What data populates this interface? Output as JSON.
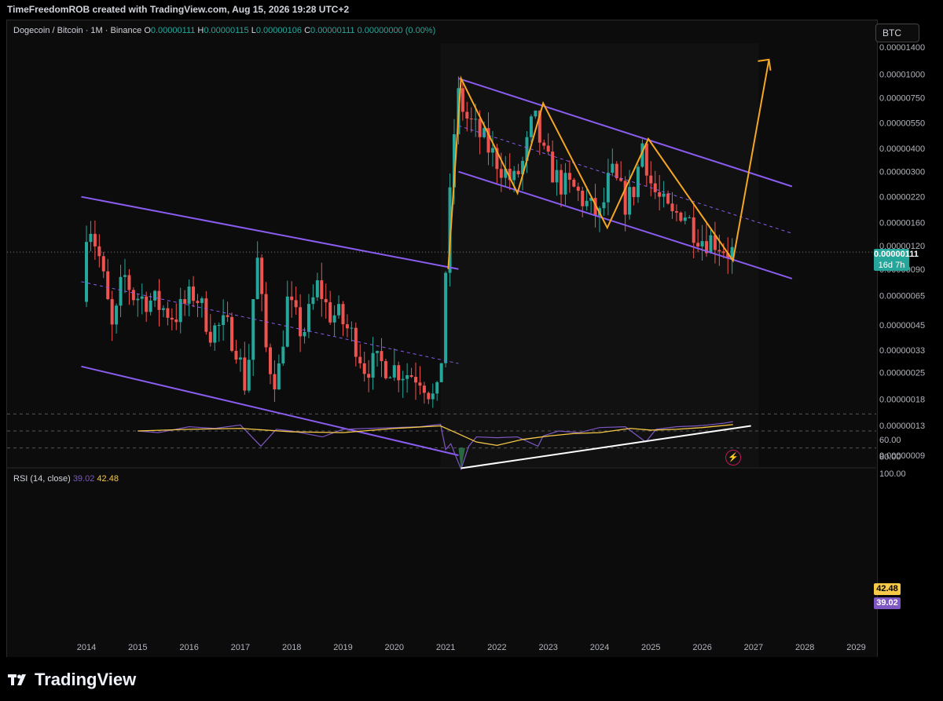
{
  "header": {
    "title": "TimeFreedomROB created with TradingView.com, Aug 15, 2026 19:28 UTC+2"
  },
  "legend": {
    "symbol": "Dogecoin / Bitcoin · 1M · Binance",
    "o_label": "O",
    "o_value": "0.00000111",
    "h_label": "H",
    "h_value": "0.00000115",
    "l_label": "L",
    "l_value": "0.00000106",
    "c_label": "C",
    "c_value": "0.00000111",
    "change": "0.00000000 (0.00%)"
  },
  "currency_button": "BTC",
  "price_label": {
    "value": "0.00000111",
    "countdown": "16d 7h"
  },
  "rsi_legend": {
    "label": "RSI (14, close)",
    "rsi_value": "39.02",
    "ma_value": "42.48"
  },
  "rsi_tags": {
    "ma": "42.48",
    "rsi": "39.02"
  },
  "brand": {
    "name": "TradingView"
  },
  "colors": {
    "up": "#26a69a",
    "down": "#ef5350",
    "channel": "#8a5cf0",
    "pattern": "#f5a623",
    "rsi": "#7e57c2",
    "rsi_ma": "#f7c948",
    "trendline": "#ffffff"
  },
  "chart_data": [
    {
      "type": "candlestick",
      "title": "Dogecoin / Bitcoin · 1M · Binance",
      "scale": "log",
      "x_ticks": [
        "2014",
        "2015",
        "2016",
        "2017",
        "2018",
        "2019",
        "2020",
        "2021",
        "2022",
        "2023",
        "2024",
        "2025",
        "2026",
        "2027",
        "2028",
        "2029"
      ],
      "y_ticks": [
        "0.00001400",
        "0.00001000",
        "0.00000750",
        "0.00000550",
        "0.00000400",
        "0.00000300",
        "0.00000220",
        "0.00000160",
        "0.00000120",
        "0.00000090",
        "0.00000065",
        "0.00000045",
        "0.00000033",
        "0.00000025",
        "0.00000018",
        "0.00000013",
        "0.00000009"
      ],
      "ylim": [
        9e-08,
        1.4e-05
      ],
      "last_price": 1.11e-06,
      "anchors": [
        [
          2014.0,
          6e-07
        ],
        [
          2014.1,
          1.8e-06
        ],
        [
          2014.35,
          1e-06
        ],
        [
          2014.6,
          4e-07
        ],
        [
          2014.8,
          8.5e-07
        ],
        [
          2015.0,
          6.5e-07
        ],
        [
          2015.4,
          6e-07
        ],
        [
          2015.8,
          5e-07
        ],
        [
          2016.2,
          6.8e-07
        ],
        [
          2016.5,
          4.2e-07
        ],
        [
          2016.8,
          4.5e-07
        ],
        [
          2017.0,
          3.5e-07
        ],
        [
          2017.2,
          2e-07
        ],
        [
          2017.4,
          1.1e-06
        ],
        [
          2017.6,
          3e-07
        ],
        [
          2017.8,
          2.2e-07
        ],
        [
          2018.0,
          6e-07
        ],
        [
          2018.3,
          4e-07
        ],
        [
          2018.6,
          7.5e-07
        ],
        [
          2018.8,
          5.2e-07
        ],
        [
          2019.0,
          5e-07
        ],
        [
          2019.3,
          3.8e-07
        ],
        [
          2019.5,
          2.7e-07
        ],
        [
          2019.8,
          2.8e-07
        ],
        [
          2020.0,
          2.7e-07
        ],
        [
          2020.3,
          2.5e-07
        ],
        [
          2020.6,
          2.4e-07
        ],
        [
          2020.9,
          1.7e-07
        ],
        [
          2021.0,
          3e-07
        ],
        [
          2021.1,
          1.1e-06
        ],
        [
          2021.3,
          8e-06
        ],
        [
          2021.5,
          5.8e-06
        ],
        [
          2021.8,
          4.5e-06
        ],
        [
          2022.0,
          3.7e-06
        ],
        [
          2022.4,
          2.6e-06
        ],
        [
          2022.6,
          3.4e-06
        ],
        [
          2022.8,
          6e-06
        ],
        [
          2023.0,
          3.6e-06
        ],
        [
          2023.3,
          2.6e-06
        ],
        [
          2023.6,
          2.4e-06
        ],
        [
          2023.9,
          1.9e-06
        ],
        [
          2024.1,
          1.7e-06
        ],
        [
          2024.3,
          3e-06
        ],
        [
          2024.6,
          2e-06
        ],
        [
          2024.8,
          2.6e-06
        ],
        [
          2024.9,
          4.5e-06
        ],
        [
          2025.1,
          2.5e-06
        ],
        [
          2025.3,
          2e-06
        ],
        [
          2025.5,
          1.7e-06
        ],
        [
          2025.7,
          1.9e-06
        ],
        [
          2025.9,
          1.5e-06
        ],
        [
          2026.1,
          1.3e-06
        ],
        [
          2026.3,
          1.3e-06
        ],
        [
          2026.6,
          1.11e-06
        ]
      ],
      "channels": [
        {
          "points": [
            [
              2013.9,
              2.2e-06
            ],
            [
              2021.25,
              9e-07
            ]
          ]
        },
        {
          "points": [
            [
              2013.9,
              2.7e-07
            ],
            [
              2021.25,
              9e-08
            ]
          ]
        },
        {
          "points": [
            [
              2021.25,
              9.5e-06
            ],
            [
              2027.75,
              2.5e-06
            ]
          ]
        },
        {
          "points": [
            [
              2021.25,
              3e-06
            ],
            [
              2027.75,
              8e-07
            ]
          ]
        }
      ],
      "midlines": [
        {
          "points": [
            [
              2013.9,
              7.7e-07
            ],
            [
              2021.25,
              2.8e-07
            ]
          ]
        },
        {
          "points": [
            [
              2021.25,
              5.3e-06
            ],
            [
              2027.75,
              1.4e-06
            ]
          ]
        }
      ],
      "projection_path": [
        [
          2021.05,
          9e-07
        ],
        [
          2021.3,
          9.5e-06
        ],
        [
          2022.4,
          2.3e-06
        ],
        [
          2022.9,
          7e-06
        ],
        [
          2024.15,
          1.5e-06
        ],
        [
          2024.95,
          4.5e-06
        ],
        [
          2026.6,
          1e-06
        ],
        [
          2027.3,
          1.2e-05
        ]
      ]
    },
    {
      "type": "line",
      "title": "RSI (14, close)",
      "ylim": [
        20,
        100
      ],
      "y_ticks": [
        "100.00",
        "80.00",
        "60.00"
      ],
      "bands": [
        30,
        50,
        70
      ],
      "series": [
        {
          "name": "RSI (14, close)",
          "x": [
            2015.0,
            2015.4,
            2016.0,
            2016.5,
            2017.0,
            2017.4,
            2017.7,
            2018.0,
            2018.6,
            2019.0,
            2019.5,
            2020.0,
            2020.5,
            2020.9,
            2021.0,
            2021.1,
            2021.3,
            2021.45,
            2021.6,
            2022.0,
            2022.4,
            2022.8,
            2022.9,
            2023.2,
            2023.6,
            2024.0,
            2024.5,
            2024.9,
            2025.1,
            2025.5,
            2025.9,
            2026.1,
            2026.4,
            2026.6
          ],
          "y": [
            50,
            52,
            45,
            47,
            43,
            68,
            48,
            50,
            57,
            48,
            47,
            46,
            45,
            42,
            72,
            65,
            95,
            68,
            57,
            58,
            57,
            68,
            56,
            50,
            52,
            46,
            45,
            63,
            48,
            45,
            44,
            43,
            41,
            39.02
          ]
        },
        {
          "name": "MA",
          "x": [
            2015.0,
            2016.0,
            2017.0,
            2018.0,
            2019.0,
            2020.0,
            2020.9,
            2021.2,
            2021.6,
            2022.0,
            2022.5,
            2023.0,
            2023.5,
            2024.0,
            2024.6,
            2025.0,
            2025.5,
            2026.0,
            2026.6
          ],
          "y": [
            50,
            48,
            47,
            51,
            52,
            47,
            44,
            52,
            63,
            67,
            60,
            56,
            53,
            52,
            47,
            49,
            48,
            46,
            42.48
          ]
        }
      ],
      "trendline": [
        [
          2021.3,
          94
        ],
        [
          2026.95,
          44
        ]
      ]
    }
  ]
}
